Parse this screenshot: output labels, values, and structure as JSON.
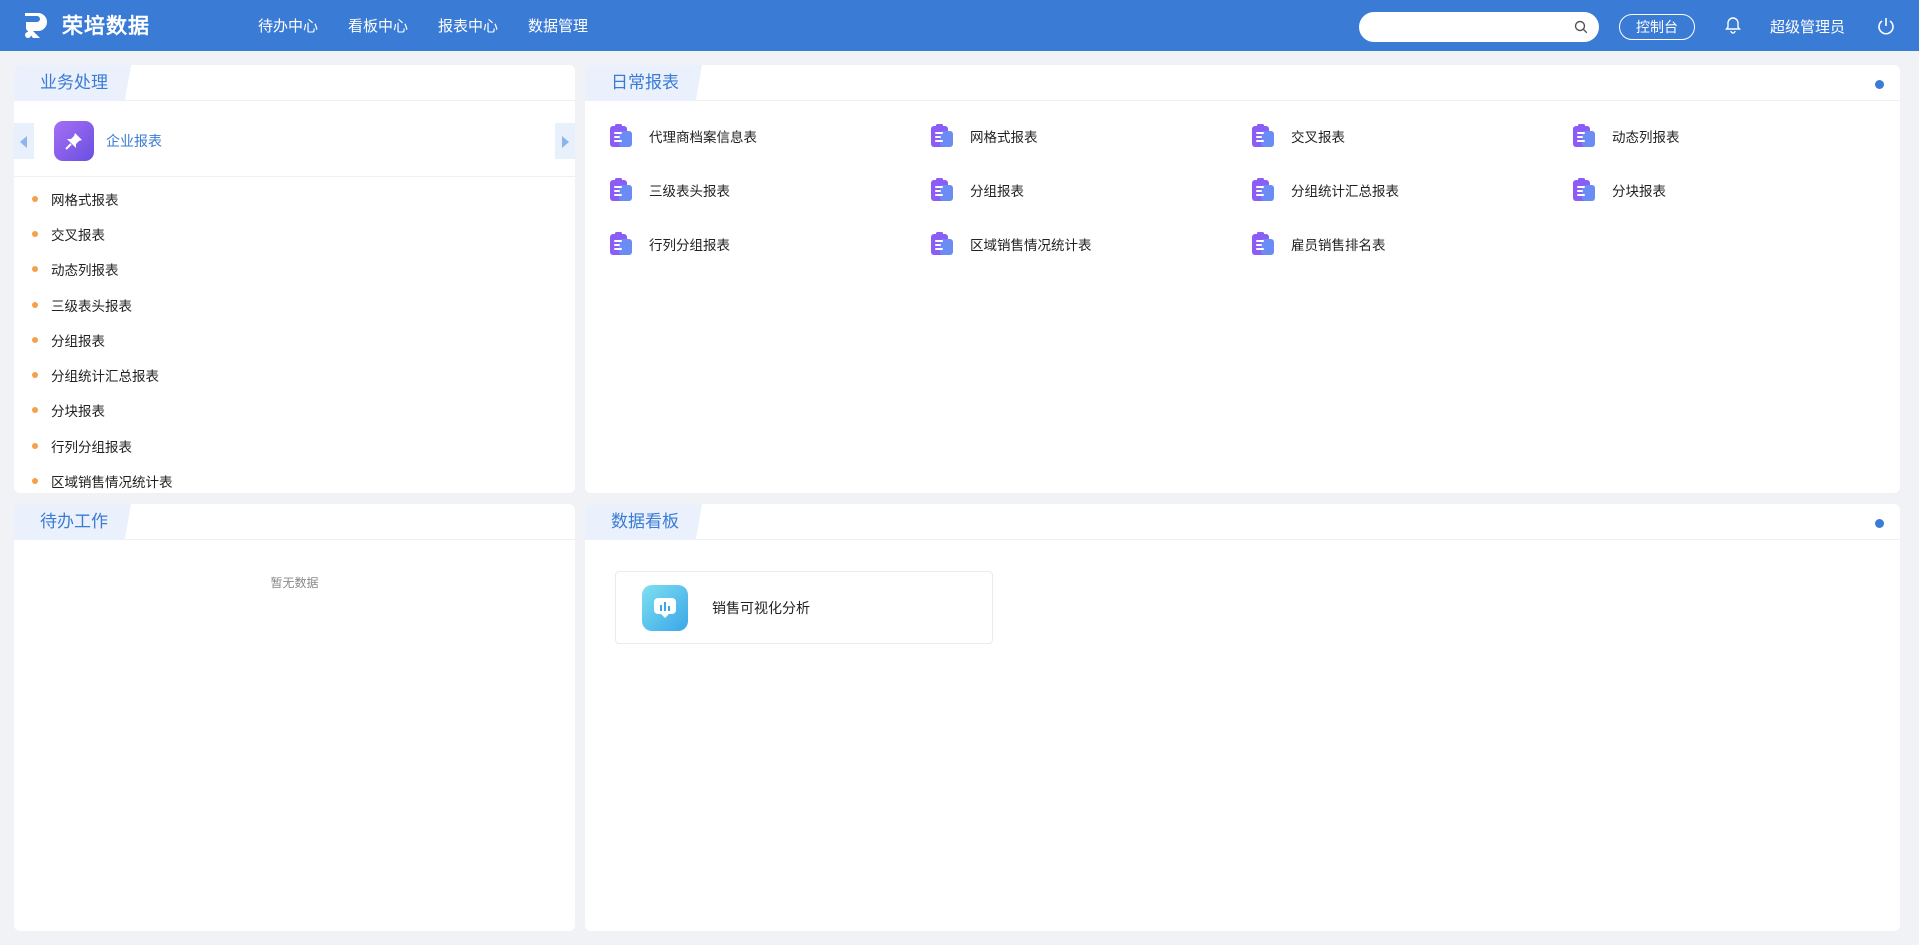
{
  "header": {
    "app_name": "荣培数据",
    "nav": [
      "待办中心",
      "看板中心",
      "报表中心",
      "数据管理"
    ],
    "search_placeholder": "",
    "console_label": "控制台",
    "username": "超级管理员"
  },
  "panels": {
    "business": {
      "title": "业务处理",
      "active_tab": "企业报表",
      "items": [
        "网格式报表",
        "交叉报表",
        "动态列报表",
        "三级表头报表",
        "分组报表",
        "分组统计汇总报表",
        "分块报表",
        "行列分组报表",
        "区域销售情况统计表"
      ]
    },
    "daily": {
      "title": "日常报表",
      "items": [
        "代理商档案信息表",
        "网格式报表",
        "交叉报表",
        "动态列报表",
        "三级表头报表",
        "分组报表",
        "分组统计汇总报表",
        "分块报表",
        "行列分组报表",
        "区域销售情况统计表",
        "雇员销售排名表"
      ]
    },
    "todo": {
      "title": "待办工作",
      "empty_text": "暂无数据"
    },
    "dashboard": {
      "title": "数据看板",
      "card_label": "销售可视化分析"
    }
  },
  "colors": {
    "primary": "#3a7bd5",
    "bullet": "#f5a04a",
    "icon_purple": "#8b5cf6"
  }
}
